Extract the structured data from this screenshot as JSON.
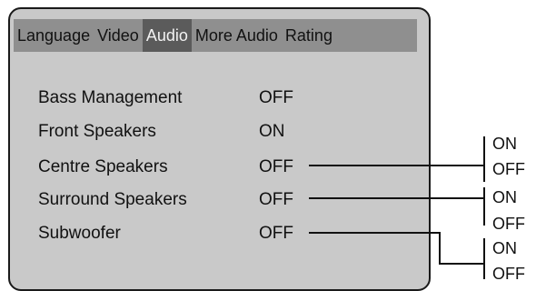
{
  "tabs": [
    {
      "label": "Language",
      "active": false
    },
    {
      "label": "Video",
      "active": false
    },
    {
      "label": "Audio",
      "active": true
    },
    {
      "label": "More Audio",
      "active": false
    },
    {
      "label": "Rating",
      "active": false
    }
  ],
  "settings": [
    {
      "label": "Bass Management",
      "value": "OFF"
    },
    {
      "label": "Front Speakers",
      "value": "ON"
    },
    {
      "label": "Centre Speakers",
      "value": "OFF"
    },
    {
      "label": "Surround Speakers",
      "value": "OFF"
    },
    {
      "label": "Subwoofer",
      "value": "OFF"
    }
  ],
  "callouts": {
    "centre": {
      "on": "ON",
      "off": "OFF"
    },
    "surround": {
      "on": "ON",
      "off": "OFF"
    },
    "subwoofer": {
      "on": "ON",
      "off": "OFF"
    }
  }
}
